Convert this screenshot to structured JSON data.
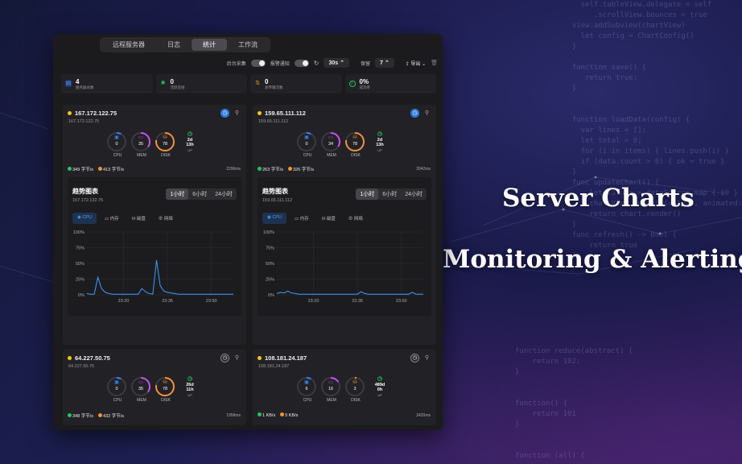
{
  "promo": {
    "line1": "Server Charts",
    "line2": "Monitoring & Alerting"
  },
  "tabs": [
    "远程服务器",
    "日志",
    "统计",
    "工作流"
  ],
  "toolbar": {
    "bg_collect": "后台采集",
    "alert_notify": "报警通知",
    "refresh": "↻",
    "interval": "30s ⌃",
    "keep_label": "保留",
    "keep": "7 ⌃",
    "export": "导出",
    "trash": "🗑"
  },
  "stats": [
    {
      "value": "4",
      "label": "服务器总数",
      "color": "#3b82f6"
    },
    {
      "value": "0",
      "label": "活跃连接",
      "color": "#22c55e"
    },
    {
      "value": "0",
      "label": "总传输次数",
      "color": "#f59e0b"
    },
    {
      "value": "0%",
      "label": "成功率",
      "color": "#22c55e"
    }
  ],
  "servers": [
    {
      "name": "167.172.122.75",
      "sub": "167.172.122.75",
      "cpu": "0",
      "mem": "35",
      "disk": "78",
      "up_d": "2d",
      "up_h": "13h",
      "up_l": "UP",
      "down": "349 字节/s",
      "upl": "413 字节/s",
      "ms": "2296ms"
    },
    {
      "name": "159.65.111.112",
      "sub": "159.65.111.112",
      "cpu": "0",
      "mem": "34",
      "disk": "78",
      "up_d": "2d",
      "up_h": "13h",
      "up_l": "UP",
      "down": "263 字节/s",
      "upl": "326 字节/s",
      "ms": "3042ms"
    },
    {
      "name": "64.227.50.75",
      "sub": "64.227.50.75",
      "cpu": "0",
      "mem": "35",
      "disk": "78",
      "up_d": "26d",
      "up_h": "11h",
      "up_l": "UP",
      "down": "348 字节/s",
      "upl": "432 字节/s",
      "ms": "1958ms"
    },
    {
      "name": "108.181.24.187",
      "sub": "108.181.24.187",
      "cpu": "6",
      "mem": "16",
      "disk": "3",
      "up_d": "489d",
      "up_h": "0h",
      "up_l": "UP",
      "down": "1 KB/s",
      "upl": "5 KB/s",
      "ms": "2420ms"
    }
  ],
  "gauge_labels": {
    "cpu": "CPU",
    "mem": "MEM",
    "disk": "DISK"
  },
  "trend": {
    "title": "趋势图表",
    "ranges": [
      "1小时",
      "6小时",
      "24小时"
    ],
    "metrics": [
      "CPU",
      "内存",
      "磁盘",
      "网络"
    ],
    "y_ticks": [
      "100%",
      "75%",
      "50%",
      "25%",
      "0%"
    ],
    "x_ticks": [
      "23:20",
      "23:35",
      "23:50"
    ]
  },
  "chart_data": [
    {
      "type": "line",
      "title": "趋势图表",
      "xlabel": "",
      "ylabel": "",
      "ylim": [
        0,
        100
      ],
      "x": [
        0,
        1,
        2,
        3,
        4,
        5,
        6,
        7,
        8,
        9,
        10,
        11,
        12,
        13,
        14,
        15,
        16,
        17,
        18,
        19,
        20,
        21,
        22,
        23,
        24,
        25,
        26,
        27,
        28,
        29,
        30,
        31,
        32,
        33,
        34,
        35,
        36,
        37,
        38,
        39,
        40
      ],
      "values": [
        2,
        1,
        1,
        28,
        10,
        4,
        2,
        1,
        1,
        1,
        1,
        1,
        1,
        1,
        1,
        10,
        5,
        2,
        1,
        55,
        15,
        6,
        4,
        3,
        2,
        1,
        1,
        1,
        1,
        1,
        1,
        1,
        1,
        1,
        1,
        1,
        1,
        1,
        1,
        1,
        1
      ],
      "x_ticks": [
        "23:20",
        "23:35",
        "23:50"
      ]
    },
    {
      "type": "line",
      "title": "趋势图表",
      "xlabel": "",
      "ylabel": "",
      "ylim": [
        0,
        100
      ],
      "x": [
        0,
        1,
        2,
        3,
        4,
        5,
        6,
        7,
        8,
        9,
        10,
        11,
        12,
        13,
        14,
        15,
        16,
        17,
        18,
        19,
        20,
        21,
        22,
        23,
        24,
        25,
        26,
        27,
        28,
        29,
        30,
        31,
        32,
        33,
        34,
        35,
        36,
        37,
        38,
        39,
        40
      ],
      "values": [
        2,
        4,
        3,
        6,
        3,
        2,
        1,
        1,
        1,
        1,
        1,
        1,
        1,
        1,
        1,
        1,
        1,
        1,
        1,
        1,
        1,
        1,
        1,
        5,
        2,
        1,
        1,
        1,
        1,
        1,
        1,
        1,
        1,
        1,
        1,
        1,
        1,
        4,
        1,
        1,
        1
      ],
      "x_ticks": [
        "23:20",
        "23:35",
        "23:50"
      ]
    }
  ]
}
